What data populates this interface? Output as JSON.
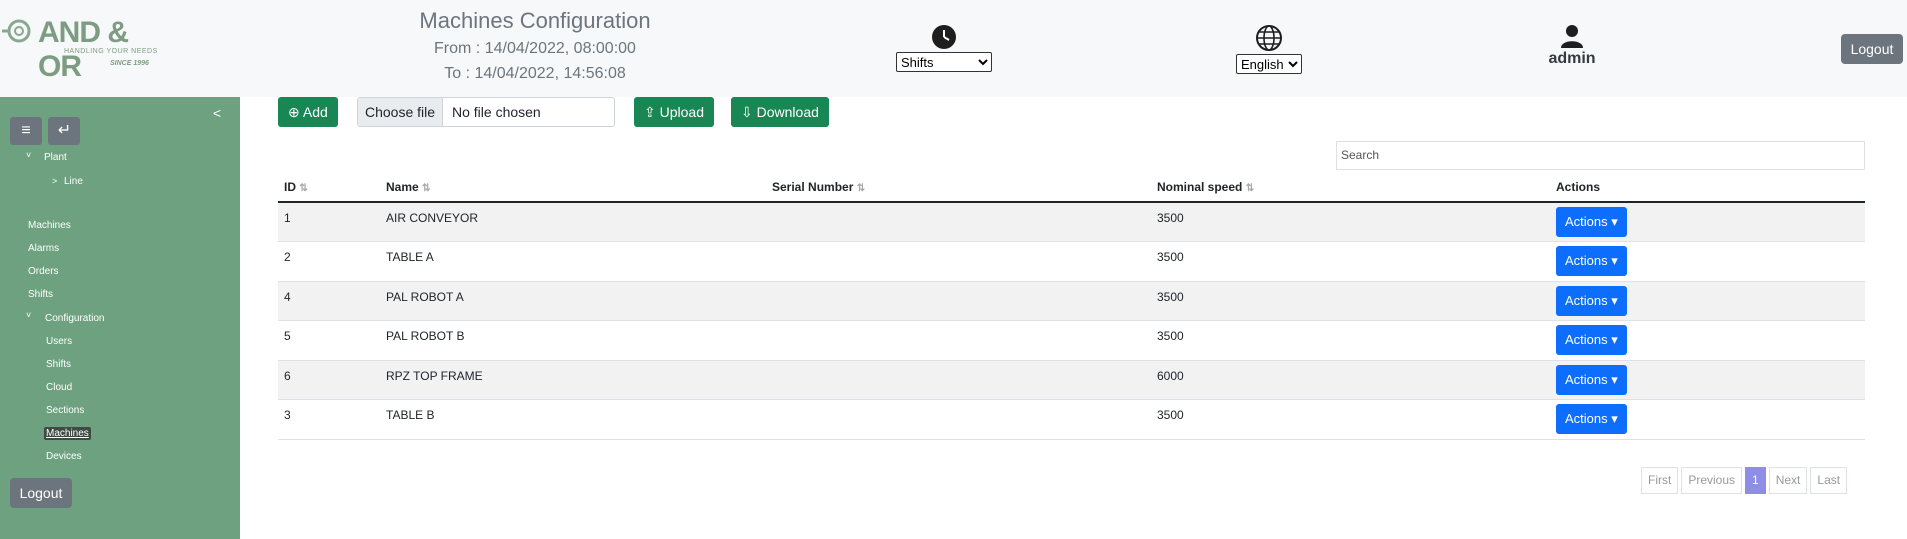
{
  "brand": {
    "name": "AND & OR",
    "tagline": "HANDLING YOUR NEEDS",
    "since": "SINCE 1996"
  },
  "header": {
    "title": "Machines Configuration",
    "from": "From : 14/04/2022, 08:00:00",
    "to": "To : 14/04/2022, 14:56:08",
    "shifts_select": "Shifts",
    "language_select": "English",
    "user": "admin",
    "logout": "Logout"
  },
  "sidebar": {
    "collapse": "<",
    "menu_icon": "≡",
    "back_icon": "↵",
    "plant": "Plant",
    "line": "Line",
    "items": [
      "Machines",
      "Alarms",
      "Orders",
      "Shifts"
    ],
    "configuration": "Configuration",
    "config_items": [
      "Users",
      "Shifts",
      "Cloud",
      "Sections",
      "Machines",
      "Devices"
    ],
    "active": "Machines",
    "logout": "Logout"
  },
  "toolbar": {
    "add": "Add",
    "choose_file": "Choose file",
    "file_status": "No file chosen",
    "upload": "Upload",
    "download": "Download"
  },
  "search": {
    "placeholder": "Search"
  },
  "table": {
    "headers": [
      "ID",
      "Name",
      "Serial Number",
      "Nominal speed",
      "Actions"
    ],
    "rows": [
      {
        "id": "1",
        "name": "AIR CONVEYOR",
        "serial": "",
        "speed": "3500",
        "action": "Actions"
      },
      {
        "id": "2",
        "name": "TABLE A",
        "serial": "",
        "speed": "3500",
        "action": "Actions"
      },
      {
        "id": "4",
        "name": "PAL ROBOT A",
        "serial": "",
        "speed": "3500",
        "action": "Actions"
      },
      {
        "id": "5",
        "name": "PAL ROBOT B",
        "serial": "",
        "speed": "3500",
        "action": "Actions"
      },
      {
        "id": "6",
        "name": "RPZ TOP FRAME",
        "serial": "",
        "speed": "6000",
        "action": "Actions"
      },
      {
        "id": "3",
        "name": "TABLE B",
        "serial": "",
        "speed": "3500",
        "action": "Actions"
      }
    ]
  },
  "pagination": {
    "first": "First",
    "previous": "Previous",
    "current": "1",
    "next": "Next",
    "last": "Last"
  },
  "colors": {
    "sidebar": "#6ea17f",
    "green_button": "#198754",
    "blue_button": "#0d6efd",
    "active_page": "#8e8ee6"
  }
}
